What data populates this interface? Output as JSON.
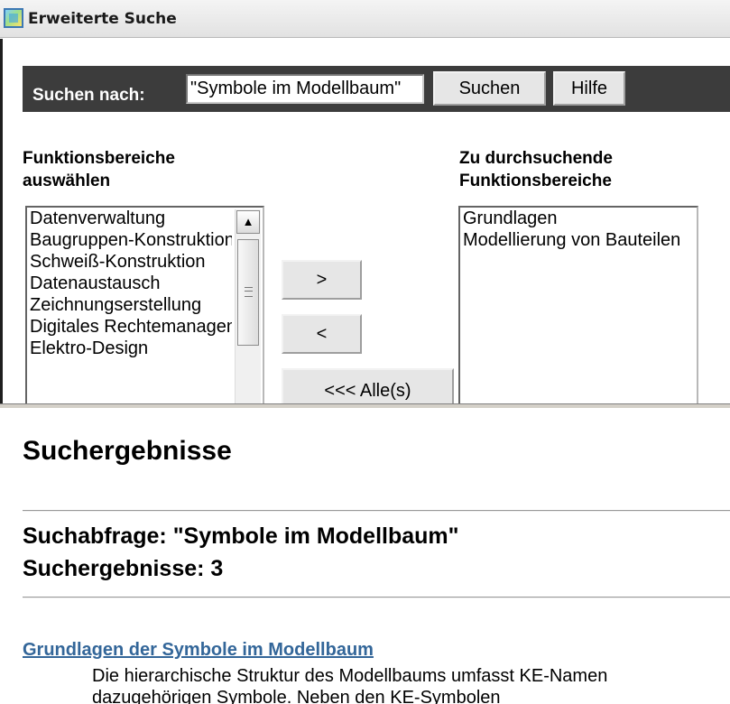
{
  "window": {
    "title": "Erweiterte Suche",
    "icon": "app-window-icon"
  },
  "search": {
    "label": "Suchen nach:",
    "value": "\"Symbole im Modellbaum\"",
    "search_button": "Suchen",
    "help_button": "Hilfe"
  },
  "areas": {
    "available_heading": "Funktionsbereiche auswählen",
    "selected_heading": "Zu durchsuchende Funktionsbereiche",
    "available": [
      "Datenverwaltung",
      "Baugruppen-Konstruktion",
      "Schweiß-Konstruktion",
      "Datenaustausch",
      "Zeichnungserstellung",
      "Digitales Rechtemanagement",
      "Elektro-Design"
    ],
    "selected": [
      "Grundlagen",
      "Modellierung von Bauteilen"
    ],
    "add_button": ">",
    "remove_button": "<",
    "remove_all_button": "<<< Alle(s)"
  },
  "results": {
    "heading": "Suchergebnisse",
    "query_line": "Suchabfrage: \"Symbole im Modellbaum\"",
    "count_line": "Suchergebnisse: 3",
    "items": [
      {
        "title": "Grundlagen der Symbole im Modellbaum",
        "description_lines": [
          "Die hierarchische Struktur des Modellbaums umfasst KE-Namen",
          "dazugehörigen Symbole. Neben den KE-Symbolen"
        ]
      }
    ]
  },
  "colors": {
    "search_bar_bg": "#3c3c3c",
    "link": "#336699"
  }
}
